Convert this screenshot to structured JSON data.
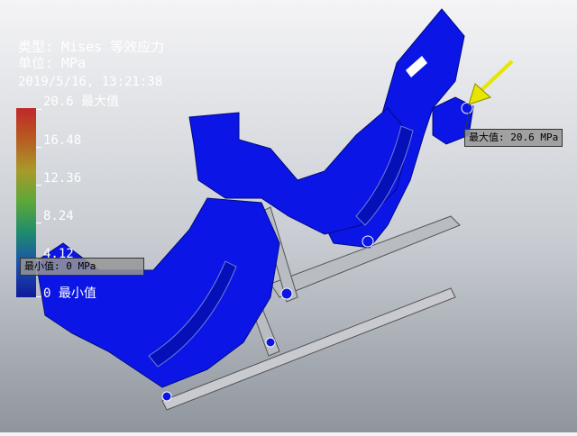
{
  "result": {
    "type_label": "类型: Mises 等效应力",
    "unit_label": "单位: MPa",
    "timestamp": "2019/5/16, 13:21:38"
  },
  "legend": {
    "max_label": "20.6 最大值",
    "ticks": [
      "16.48",
      "12.36",
      "8.24",
      "4.12"
    ],
    "min_label": "0 最小值",
    "colors": [
      "#c0282a",
      "#a89a2a",
      "#5aa83a",
      "#1e8b6e",
      "#101a9a"
    ]
  },
  "probes": {
    "max": "最大值: 20.6 MPa",
    "min": "最小值: 0 MPa"
  },
  "model": {
    "main_color": "#0b16e6",
    "arrow_color": "#e6e600"
  }
}
